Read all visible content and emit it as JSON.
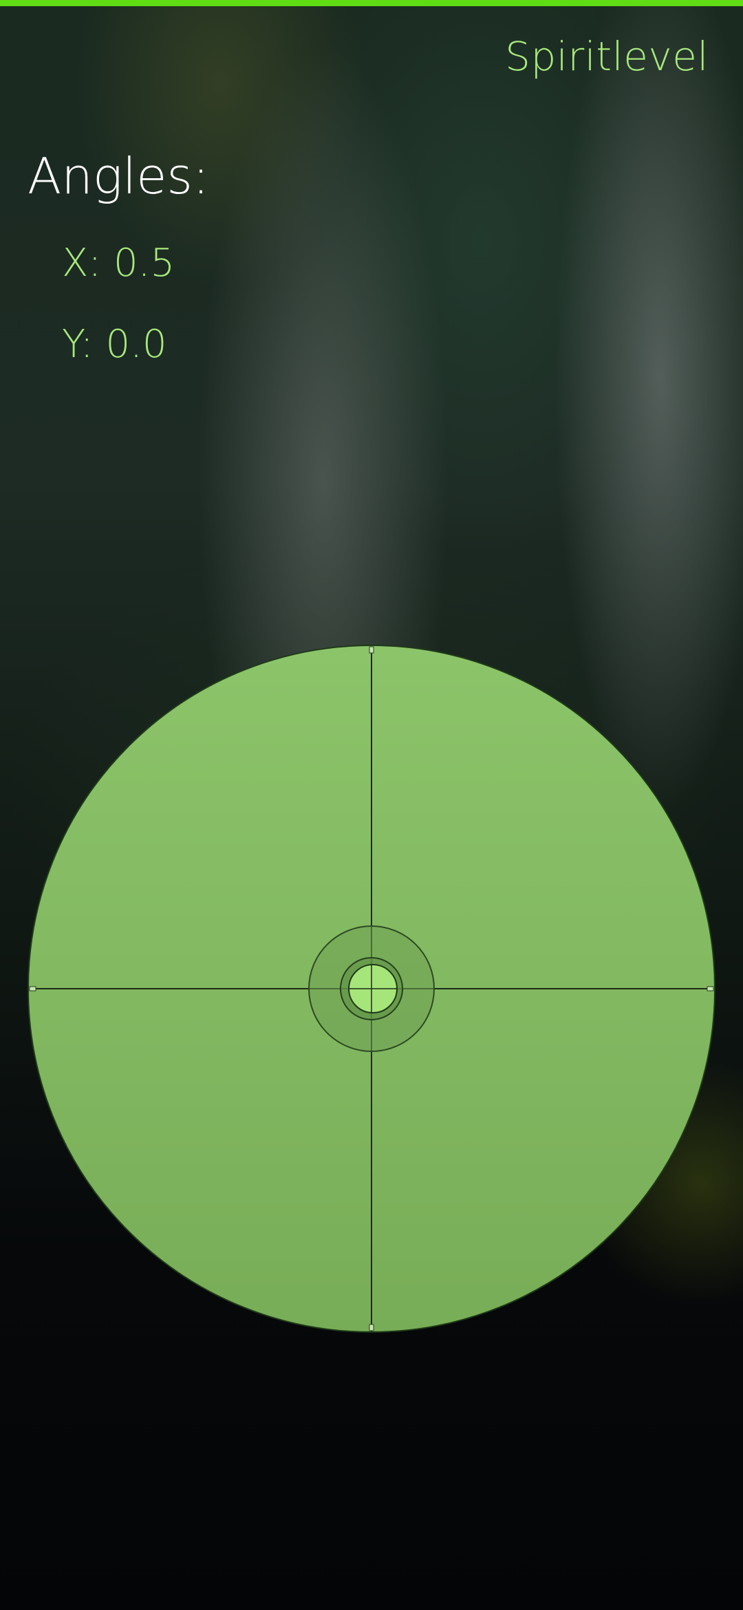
{
  "app": {
    "title": "Spiritlevel",
    "accent_color": "#5fdc14",
    "bubble_color": "#a6e57a",
    "disc_color": "#86be64"
  },
  "angles": {
    "heading": "Angles:",
    "x_prefix": "X: ",
    "x_value": "0.5",
    "y_prefix": "Y: ",
    "y_value": "0.0"
  }
}
